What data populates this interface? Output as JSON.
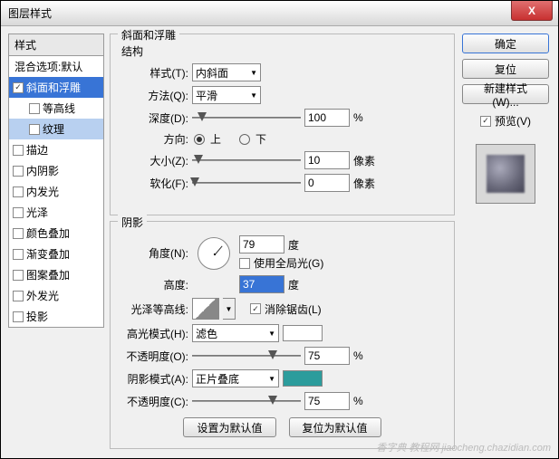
{
  "title": "图层样式",
  "close": "X",
  "stylesHeader": "样式",
  "styles": {
    "blend": "混合选项:默认",
    "bevel": "斜面和浮雕",
    "contour": "等高线",
    "texture": "纹理",
    "stroke": "描边",
    "innerShadow": "内阴影",
    "innerGlow": "内发光",
    "satin": "光泽",
    "colorOverlay": "颜色叠加",
    "gradientOverlay": "渐变叠加",
    "patternOverlay": "图案叠加",
    "outerGlow": "外发光",
    "dropShadow": "投影"
  },
  "section": {
    "main": "斜面和浮雕",
    "structure": "结构",
    "shading": "阴影"
  },
  "labels": {
    "style": "样式(T):",
    "technique": "方法(Q):",
    "depth": "深度(D):",
    "direction": "方向:",
    "up": "上",
    "down": "下",
    "size": "大小(Z):",
    "soften": "软化(F):",
    "angle": "角度(N):",
    "useGlobal": "使用全局光(G)",
    "altitude": "高度:",
    "glossContour": "光泽等高线:",
    "antiAlias": "消除锯齿(L)",
    "highlightMode": "高光模式(H):",
    "opacity1": "不透明度(O):",
    "shadowMode": "阴影模式(A):",
    "opacity2": "不透明度(C):",
    "percent": "%",
    "px": "像素",
    "deg": "度"
  },
  "values": {
    "style": "内斜面",
    "technique": "平滑",
    "depth": "100",
    "size": "10",
    "soften": "0",
    "angle": "79",
    "altitude": "37",
    "highlightMode": "滤色",
    "opacity1": "75",
    "shadowMode": "正片叠底",
    "opacity2": "75",
    "highlightColor": "#ffffff",
    "shadowColor": "#2c9c9c"
  },
  "buttons": {
    "ok": "确定",
    "cancel": "复位",
    "newStyle": "新建样式(W)...",
    "preview": "预览(V)",
    "makeDefault": "设置为默认值",
    "resetDefault": "复位为默认值"
  },
  "watermark": "香字典 教程网 jiaocheng.chazidian.com"
}
